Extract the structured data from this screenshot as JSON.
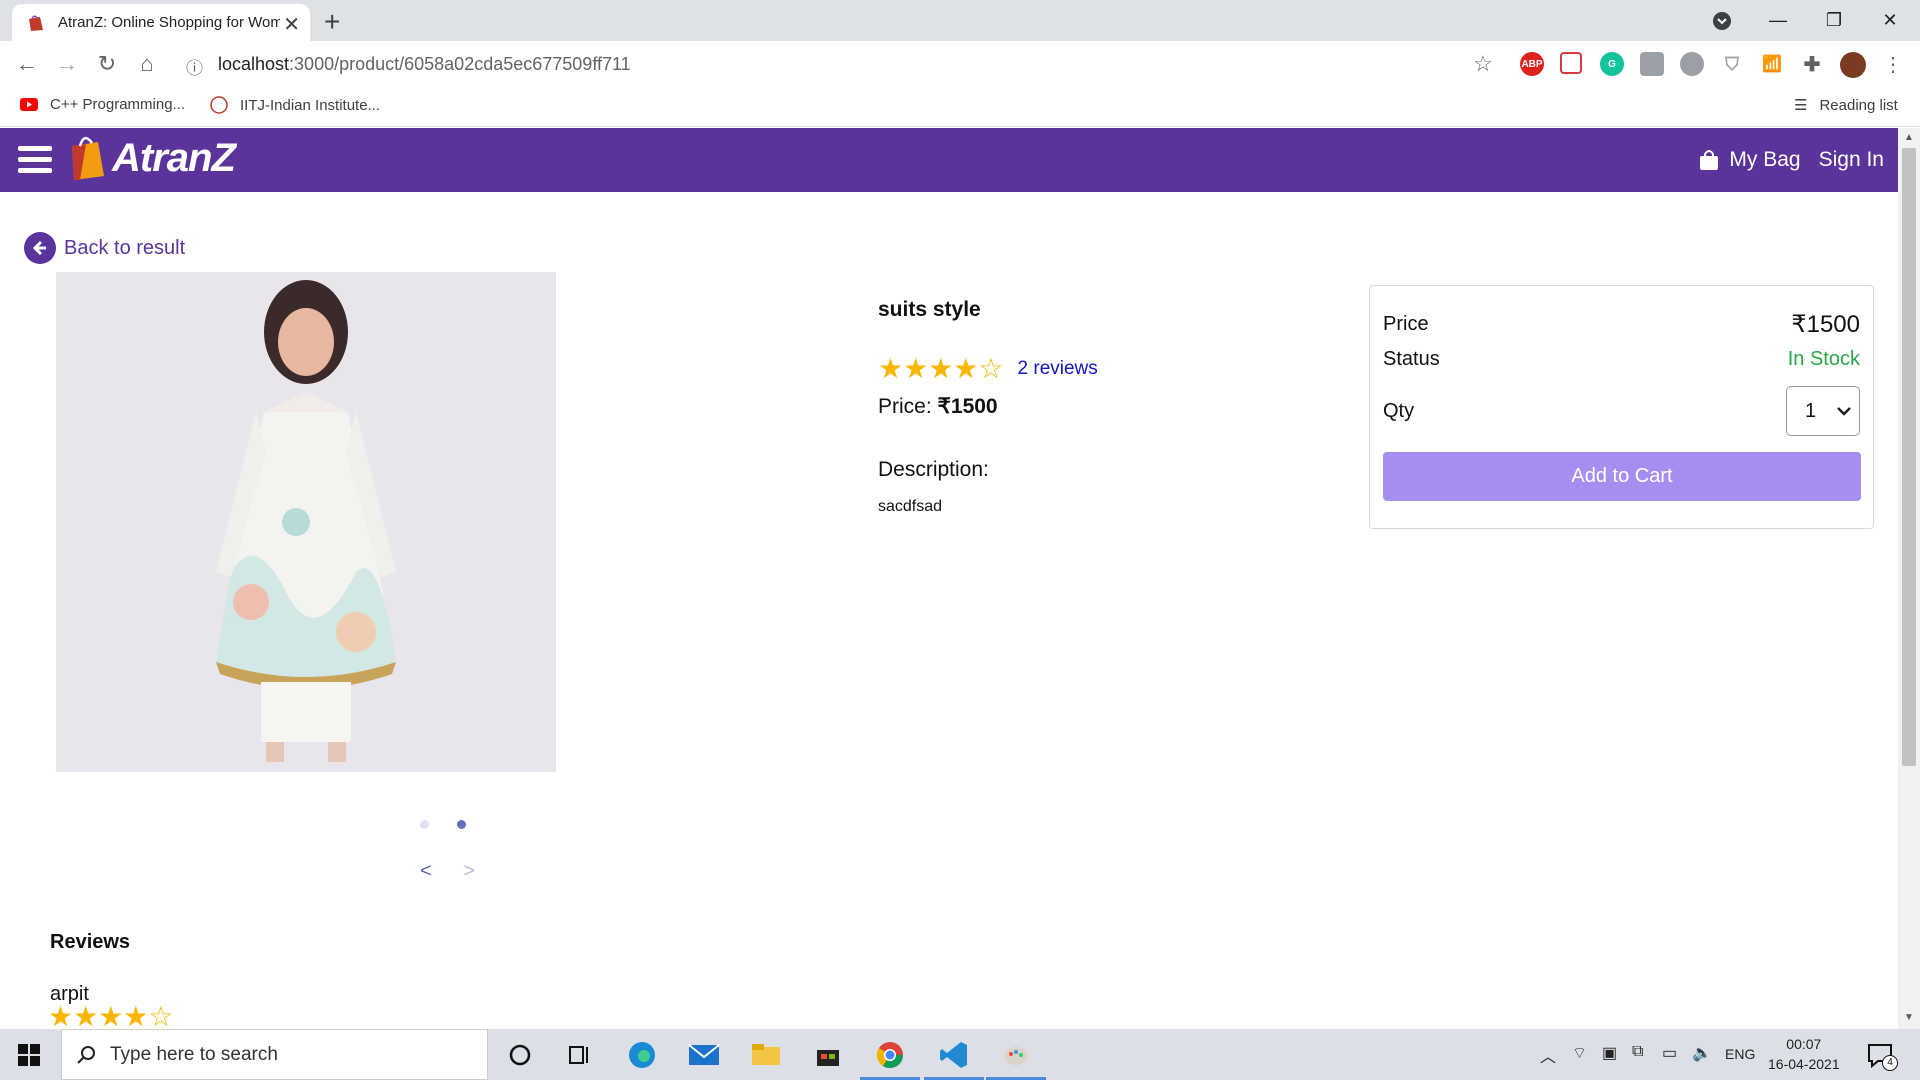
{
  "browser": {
    "tab_title": "AtranZ: Online Shopping for Women",
    "new_tab": "+",
    "url_host": "localhost",
    "url_rest": ":3000/product/6058a02cda5ec677509ff711",
    "bookmarks": [
      "C++ Programming...",
      "IITJ-Indian Institute..."
    ],
    "reading_list": "Reading list",
    "ext_abp": "ABP"
  },
  "app": {
    "brand": "AtranZ",
    "nav": {
      "my_bag": "My Bag",
      "sign_in": "Sign In"
    },
    "back_label": "Back to result",
    "product": {
      "name": "suits style",
      "rating": 4,
      "rating_max": 5,
      "reviews_link": "2 reviews",
      "price_label": "Price:",
      "price_value": "₹1500",
      "description_label": "Description:",
      "description": "sacdfsad"
    },
    "carousel": {
      "slide_count": 2,
      "active_index": 1,
      "prev": "<",
      "next": ">"
    },
    "card": {
      "price_label": "Price",
      "price_value": "₹1500",
      "status_label": "Status",
      "status_value": "In Stock",
      "qty_label": "Qty",
      "qty_value": "1",
      "add_to_cart": "Add to Cart"
    },
    "reviews": {
      "heading": "Reviews",
      "items": [
        {
          "author": "arpit",
          "rating": 4
        }
      ]
    },
    "colors": {
      "brand_purple": "#5a349a",
      "in_stock": "#28a745",
      "star": "#f8b600",
      "button": "#a58ef0"
    }
  },
  "taskbar": {
    "search_placeholder": "Type here to search",
    "language": "ENG",
    "time": "00:07",
    "date": "16-04-2021",
    "notification_count": "4"
  }
}
